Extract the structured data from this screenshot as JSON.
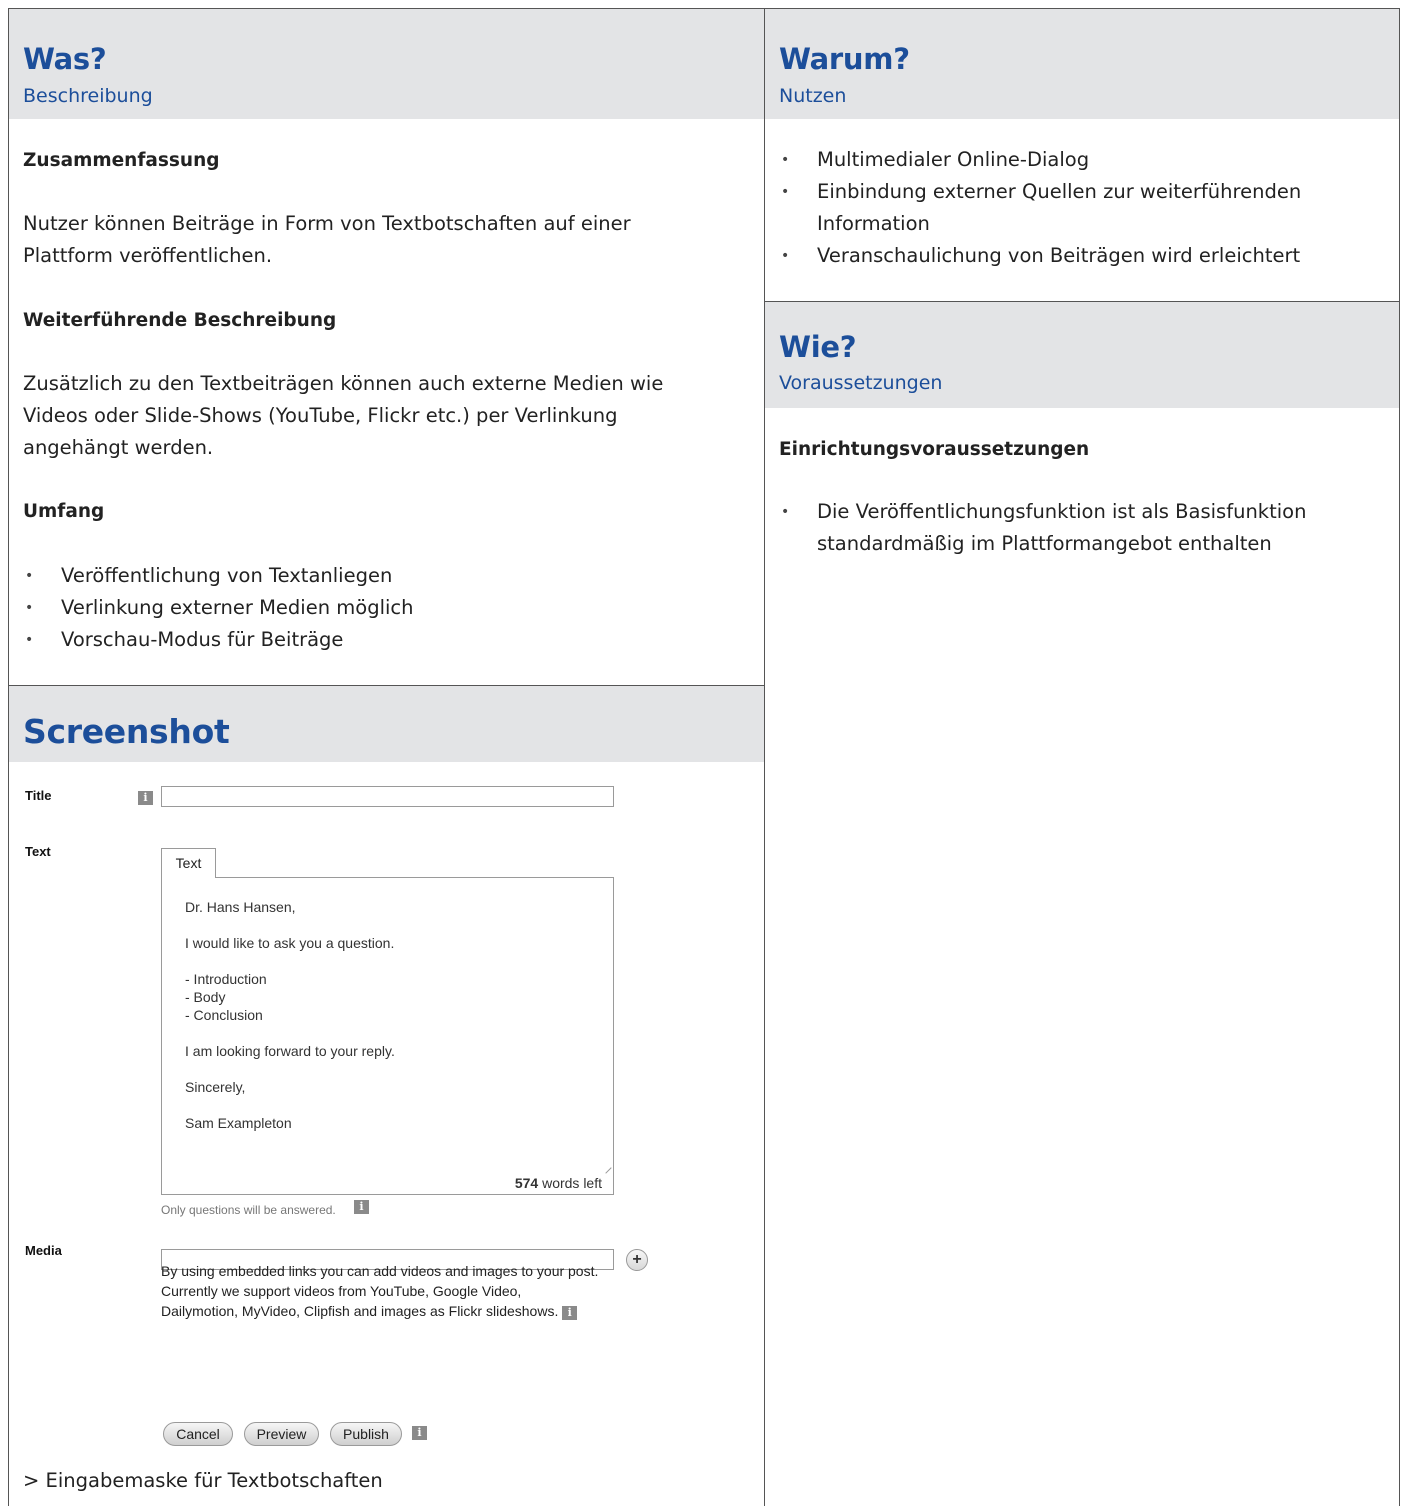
{
  "was": {
    "title": "Was?",
    "subtitle": "Beschreibung"
  },
  "summary": {
    "heading": "Zusammenfassung",
    "text": "Nutzer können Beiträge in Form von Textbotschaften auf  einer Plattform veröffentlichen."
  },
  "further": {
    "heading": "Weiterführende Beschreibung",
    "text": "Zusätzlich zu den Textbeiträgen können auch externe Medien wie Videos oder Slide-Shows (YouTube, Flickr etc.) per Verlinkung angehängt werden."
  },
  "scope": {
    "heading": "Umfang",
    "items": [
      "Veröffentlichung von Textanliegen",
      "Verlinkung externer Medien möglich",
      "Vorschau-Modus für Beiträge"
    ]
  },
  "warum": {
    "title": "Warum?",
    "subtitle": "Nutzen",
    "items": [
      "Multimedialer Online-Dialog",
      "Einbindung externer Quellen zur weiterführenden Information",
      "Veranschaulichung von Beiträgen wird erleichtert"
    ]
  },
  "wie": {
    "title": "Wie?",
    "subtitle": "Voraussetzungen",
    "heading": "Einrichtungsvoraussetzungen",
    "items": [
      "Die Veröffentlichungsfunktion ist als Basisfunktion standardmäßig im Plattformangebot enthalten"
    ]
  },
  "screenshot": {
    "title": "Screenshot",
    "caption": "> Eingabemaske für Textbotschaften",
    "form": {
      "title_label": "Title",
      "text_label": "Text",
      "tab_label": "Text",
      "body": "Dr. Hans Hansen,\n\nI would like to ask you a question.\n\n- Introduction\n- Body\n- Conclusion\n\nI am looking forward to your reply.\n\nSincerely,\n\nSam Exampleton",
      "words_count": "574",
      "words_suffix": "words left",
      "hint": "Only questions will be answered.",
      "media_label": "Media",
      "plus": "+",
      "media_help": "By using embedded links you can add videos and images to your post. Currently we support videos from YouTube, Google Video, Dailymotion, MyVideo, Clipfish and images as Flickr slideshows.",
      "info_glyph": "i",
      "buttons": {
        "cancel": "Cancel",
        "preview": "Preview",
        "publish": "Publish"
      }
    }
  }
}
